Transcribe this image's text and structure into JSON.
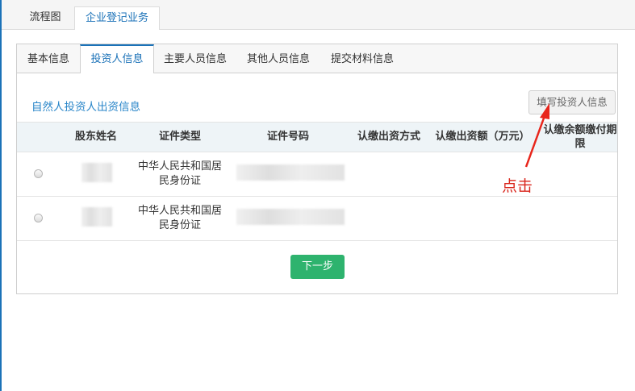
{
  "top_tabs": [
    {
      "label": "流程图"
    },
    {
      "label": "企业登记业务"
    }
  ],
  "sub_tabs": [
    {
      "label": "基本信息"
    },
    {
      "label": "投资人信息"
    },
    {
      "label": "主要人员信息"
    },
    {
      "label": "其他人员信息"
    },
    {
      "label": "提交材料信息"
    }
  ],
  "active_sub_tab": "投资人信息",
  "section": {
    "title": "自然人投资人出资信息",
    "fill_button": "填写投资人信息"
  },
  "table": {
    "headers": [
      "股东姓名",
      "证件类型",
      "证件号码",
      "认缴出资方式",
      "认缴出资额（万元）",
      "认缴余额缴付期限"
    ],
    "rows": [
      {
        "id_type": "中华人民共和国居民身份证"
      },
      {
        "id_type": "中华人民共和国居民身份证"
      }
    ]
  },
  "next_button": "下一步",
  "annotation": {
    "text": "点击",
    "color": "#d9261c"
  },
  "colors": {
    "accent": "#1b72b8",
    "link": "#2a86c9",
    "primary_button": "#2eb36e"
  }
}
